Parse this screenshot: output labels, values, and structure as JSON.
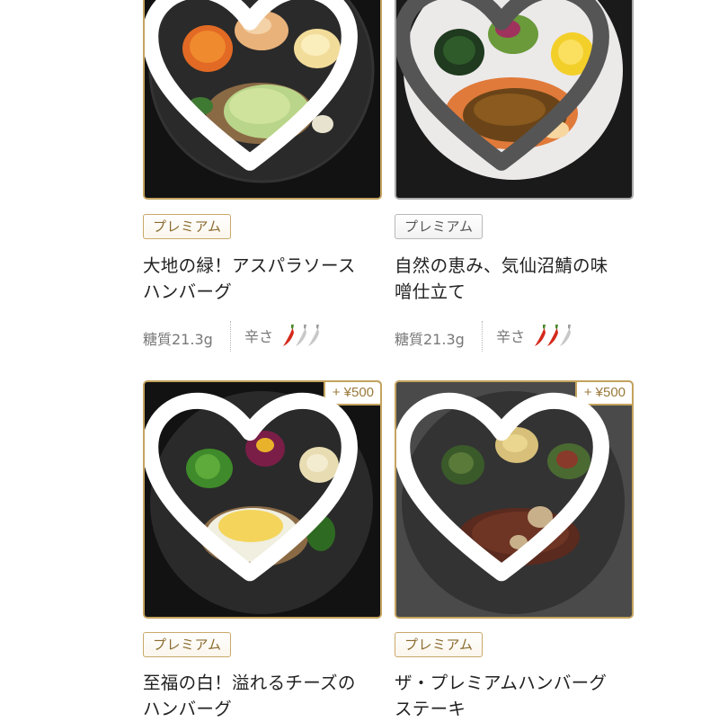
{
  "cards": [
    {
      "badge": "プレミアム",
      "badge_style": "gold",
      "title_line1": "大地の緑！アスパラソース",
      "title_line2": "ハンバーグ",
      "carbs": "糖質21.3g",
      "spicy_label": "辛さ",
      "spice_level": 1,
      "spice_max": 3,
      "favorite_icon": "heart-outline-icon"
    },
    {
      "badge": "プレミアム",
      "badge_style": "silver",
      "title_line1": "自然の恵み、気仙沼鯖の味",
      "title_line2": "噌仕立て",
      "carbs": "糖質21.3g",
      "spicy_label": "辛さ",
      "spice_level": 2,
      "spice_max": 3,
      "favorite_icon": "heart-outline-icon"
    },
    {
      "price_tag": "+ ¥500",
      "badge": "プレミアム",
      "badge_style": "gold",
      "title_line1": "至福の白！溢れるチーズの",
      "title_line2": "ハンバーグ",
      "favorite_icon": "heart-outline-icon"
    },
    {
      "price_tag": "+ ¥500",
      "badge": "プレミアム",
      "badge_style": "gold",
      "title_line1": "ザ・プレミアムハンバーグ",
      "title_line2": "ステーキ",
      "favorite_icon": "heart-outline-icon"
    }
  ],
  "colors": {
    "gold_border": "#c4a35e",
    "silver_border": "#a9a9a9",
    "pepper_red": "#d42a1c",
    "pepper_gray": "#c8c8c8"
  }
}
